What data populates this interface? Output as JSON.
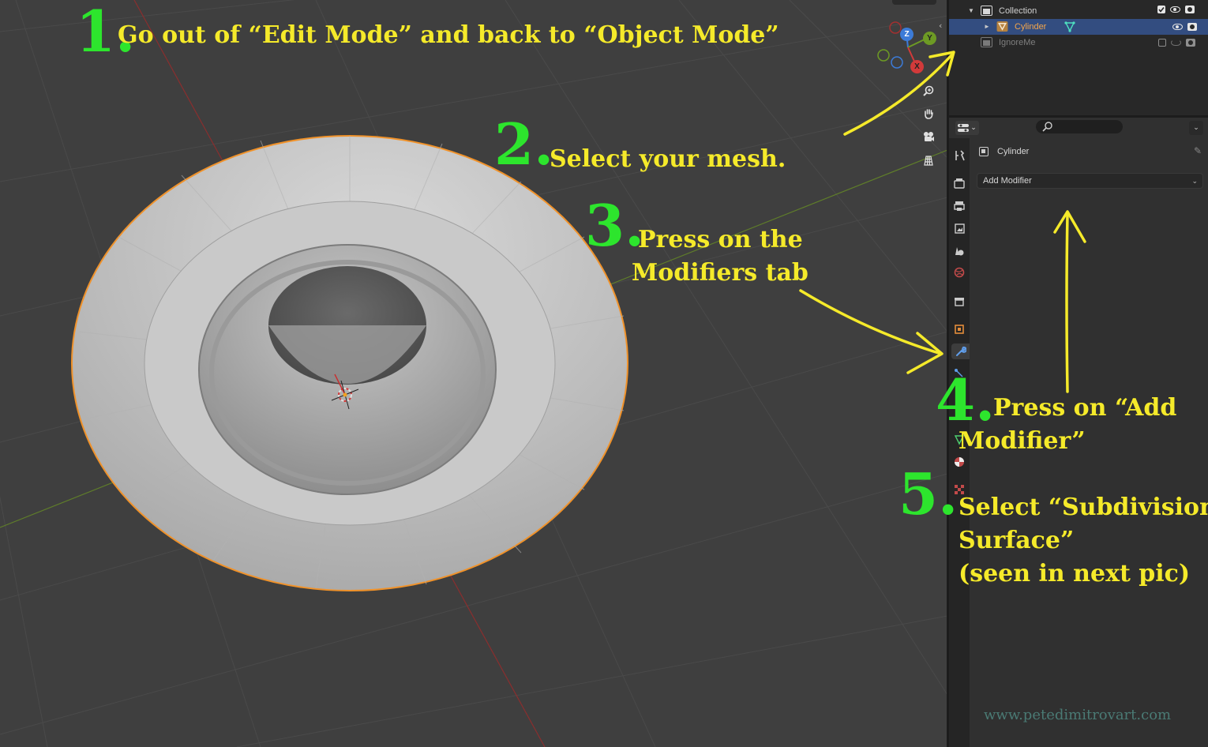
{
  "viewport": {
    "gizmo_axes": [
      "Z",
      "Y",
      "X"
    ],
    "gizmo_tools": [
      "zoom-icon",
      "hand-icon",
      "camera-icon",
      "grid-icon"
    ]
  },
  "outliner": {
    "rows": [
      {
        "label": "Collection",
        "type": "collection",
        "selected": false
      },
      {
        "label": "Cylinder",
        "type": "mesh",
        "selected": true
      },
      {
        "label": "IgnoreMe",
        "type": "collection",
        "selected": false
      }
    ]
  },
  "properties": {
    "object_name": "Cylinder",
    "add_modifier_label": "Add Modifier",
    "active_tab": "modifiers"
  },
  "annotations": {
    "step1_number": "1.",
    "step1_text": "Go out of “Edit Mode” and back to “Object Mode”",
    "step2_number": "2.",
    "step2_text": "Select your mesh.",
    "step3_number": "3.",
    "step3_line1": "Press on the",
    "step3_line2": "Modifiers tab",
    "step4_number": "4.",
    "step4_line1": "Press on “Add",
    "step4_line2": "Modifier”",
    "step5_number": "5.",
    "step5_line1": "Select “Subdivision",
    "step5_line2": "Surface”",
    "step5_line3": "(seen in next pic)"
  },
  "watermark": "www.petedimitrovart.com",
  "colors": {
    "annotation_text": "#f5ea2a",
    "step_numbers": "#2de52d",
    "selection_outline": "#f0922a",
    "selected_row": "#334d80"
  }
}
